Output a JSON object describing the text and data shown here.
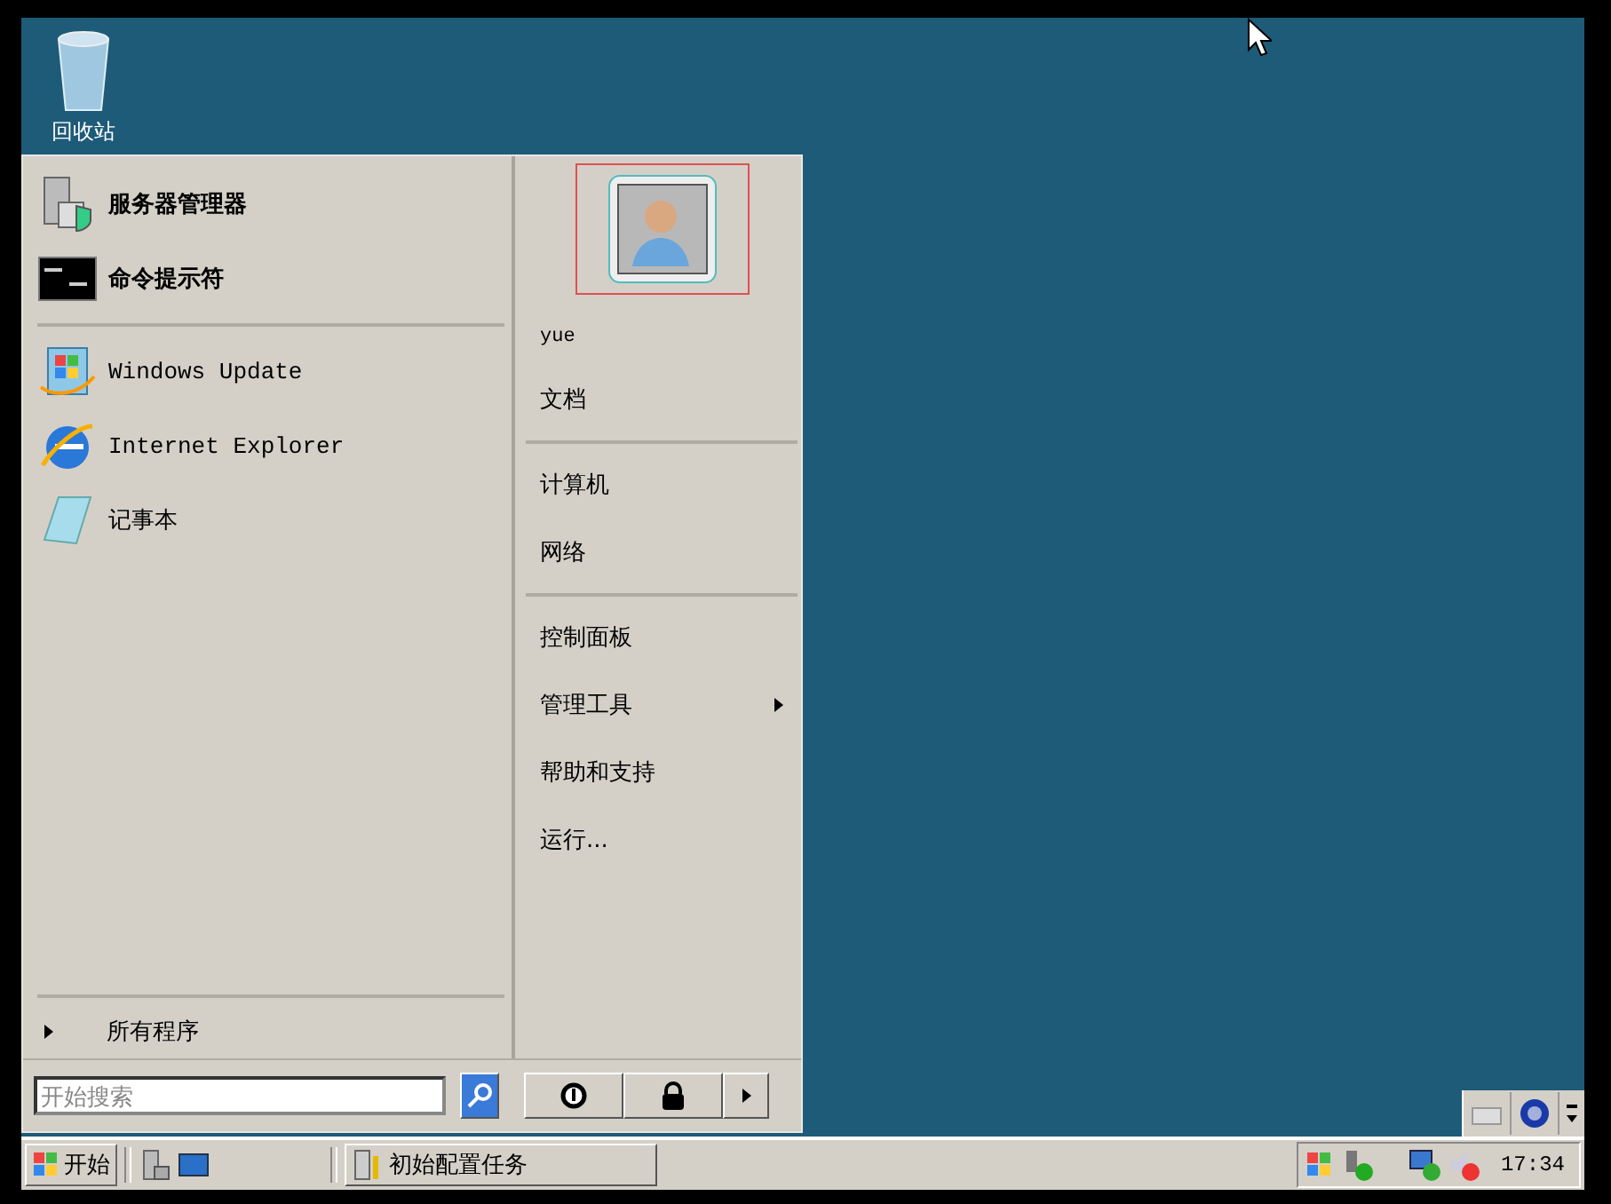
{
  "desktop_icons": [
    {
      "label": "回收站"
    }
  ],
  "start_menu": {
    "pinned": [
      {
        "label": "服务器管理器"
      },
      {
        "label": "命令提示符"
      }
    ],
    "recent": [
      {
        "label": "Windows Update"
      },
      {
        "label": "Internet Explorer"
      },
      {
        "label": "记事本"
      }
    ],
    "all_programs": "所有程序",
    "search": {
      "placeholder": "开始搜索"
    },
    "user": "yue",
    "places": [
      [
        {
          "label": "文档",
          "has_submenu": false
        }
      ],
      [
        {
          "label": "计算机",
          "has_submenu": false
        },
        {
          "label": "网络",
          "has_submenu": false
        }
      ],
      [
        {
          "label": "控制面板",
          "has_submenu": false
        },
        {
          "label": "管理工具",
          "has_submenu": true
        },
        {
          "label": "帮助和支持",
          "has_submenu": false
        },
        {
          "label": "运行...",
          "has_submenu": false
        }
      ]
    ]
  },
  "taskbar": {
    "start": "开始",
    "tasks": [
      {
        "label": "初始配置任务"
      }
    ],
    "clock": "17:34"
  }
}
